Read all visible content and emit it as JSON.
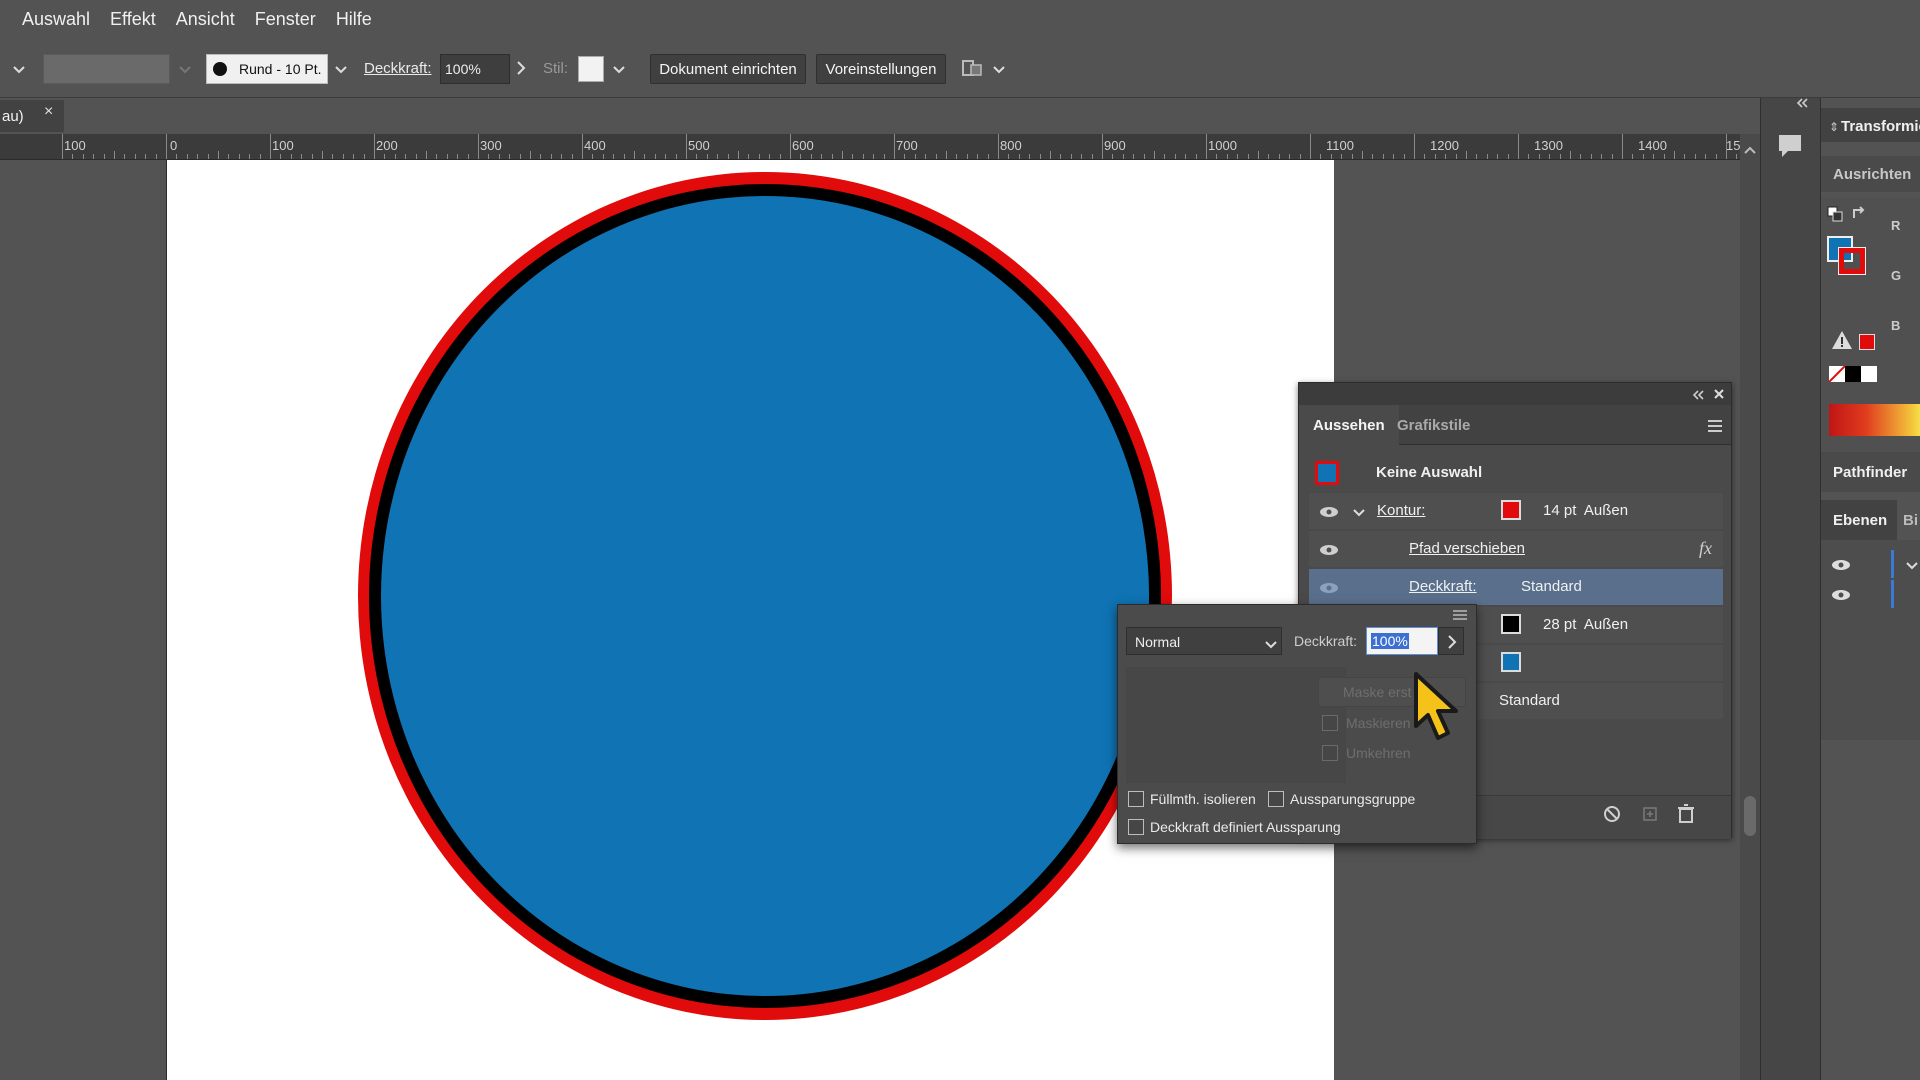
{
  "menu": {
    "items": [
      "Auswahl",
      "Effekt",
      "Ansicht",
      "Fenster",
      "Hilfe"
    ]
  },
  "controlbar": {
    "stroke_style": "Rund - 10 Pt.",
    "opacity_label": "Deckkraft:",
    "opacity_value": "100%",
    "style_label": "Stil:",
    "btn_document_setup": "Dokument einrichten",
    "btn_preferences": "Voreinstellungen"
  },
  "document": {
    "tab_label": "au)",
    "close_glyph": "×"
  },
  "ruler": {
    "labels": [
      "100",
      "0",
      "100",
      "200",
      "300",
      "400",
      "500",
      "600",
      "700",
      "800",
      "900",
      "1000",
      "1100",
      "1200",
      "1300",
      "1400",
      "15"
    ]
  },
  "artwork": {
    "fill_color": "#0f73b4",
    "inner_stroke_color": "#000000",
    "outer_stroke_color": "#e10b0b"
  },
  "right_panel": {
    "transform": "Transformie",
    "align": "Ausrichten",
    "r": "R",
    "g": "G",
    "b": "B",
    "pathfinder": "Pathfinder",
    "layers": "Ebenen",
    "libraries": "Bi"
  },
  "appearance": {
    "tab_active": "Aussehen",
    "tab_inactive": "Grafikstile",
    "no_selection": "Keine Auswahl",
    "stroke_label": "Kontur:",
    "stroke_value": "14 pt  Außen",
    "stroke_color": "#e10b0b",
    "effect_label": "Pfad verschieben",
    "fx_glyph": "fx",
    "opacity_label": "Deckkraft:",
    "opacity_value": "Standard",
    "stroke2_value": "28 pt  Außen",
    "stroke2_color": "#000000",
    "fill_color": "#0f73b4",
    "opacity2_value": "Standard"
  },
  "transparency": {
    "blend_mode": "Normal",
    "opacity_label": "Deckkraft:",
    "opacity_value": "100%",
    "make_mask": "Maske erst",
    "clip": "Maskieren",
    "invert": "Umkehren",
    "isolate_blending": "Füllmth. isolieren",
    "knockout_group": "Aussparungsgruppe",
    "opacity_mask_knockout": "Deckkraft definiert Aussparung"
  }
}
